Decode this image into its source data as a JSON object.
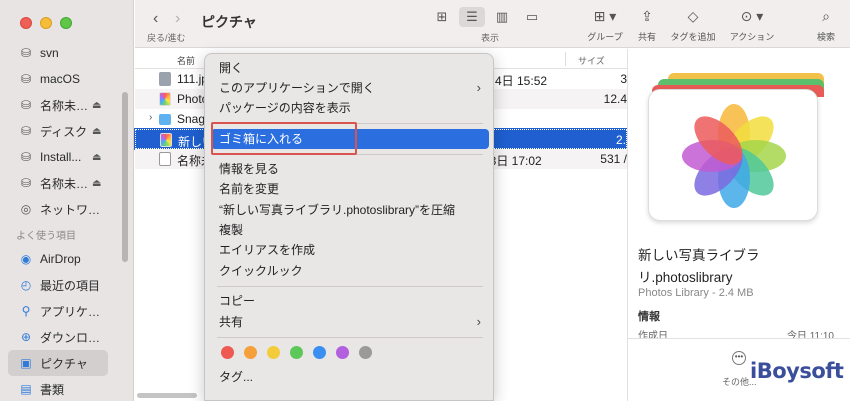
{
  "toolbar": {
    "nav_label": "戻る/進む",
    "title": "ピクチャ",
    "view_label": "表示",
    "group_label": "グループ",
    "share_label": "共有",
    "tag_label": "タグを追加",
    "action_label": "アクション",
    "search_label": "検索"
  },
  "sidebar": {
    "items_top": [
      {
        "label": "svn"
      },
      {
        "label": "macOS"
      },
      {
        "label": "名称未…"
      },
      {
        "label": "ディスク"
      },
      {
        "label": "Install..."
      },
      {
        "label": "名称未…"
      },
      {
        "label": "ネットワ…"
      }
    ],
    "favorites_heading": "よく使う項目",
    "favorites": [
      {
        "label": "AirDrop"
      },
      {
        "label": "最近の項目"
      },
      {
        "label": "アプリケ…"
      },
      {
        "label": "ダウンロ…"
      },
      {
        "label": "ピクチャ"
      },
      {
        "label": "書類"
      }
    ]
  },
  "list": {
    "col_name": "名前",
    "col_size": "サイズ",
    "rows": [
      {
        "name": "111.jpg",
        "date": "月4日 15:52",
        "size": "3"
      },
      {
        "name": "Photos",
        "date": "",
        "size": "12.4"
      },
      {
        "name": "Snagit",
        "date": "",
        "size": ""
      },
      {
        "name": "新しい",
        "date": "",
        "size": "2."
      },
      {
        "name": "名称未設定",
        "date": "13日 17:02",
        "size": "531 /"
      }
    ]
  },
  "context_menu": {
    "items": [
      {
        "label": "開く"
      },
      {
        "label": "このアプリケーションで開く"
      },
      {
        "label": "パッケージの内容を表示"
      },
      {
        "label": "ゴミ箱に入れる"
      },
      {
        "label": "情報を見る"
      },
      {
        "label": "名前を変更"
      },
      {
        "label": "“新しい写真ライブラリ.photoslibrary”を圧縮"
      },
      {
        "label": "複製"
      },
      {
        "label": "エイリアスを作成"
      },
      {
        "label": "クイックルック"
      },
      {
        "label": "コピー"
      },
      {
        "label": "共有"
      },
      {
        "label": "タグ..."
      }
    ],
    "tag_colors": [
      "#ee5a52",
      "#f5a03a",
      "#f4cc3b",
      "#5cc85a",
      "#3b8ff0",
      "#b25fe0",
      "#9a9a9a"
    ]
  },
  "preview": {
    "name": "新しい写真ライブラリ.photoslibrary",
    "kind": "Photos Library - 2.4 MB",
    "info_heading": "情報",
    "cut_left": "作成日",
    "cut_right": "今日 11:10",
    "more_label": "その他..."
  },
  "watermark": {
    "text": "iBoysoft"
  }
}
